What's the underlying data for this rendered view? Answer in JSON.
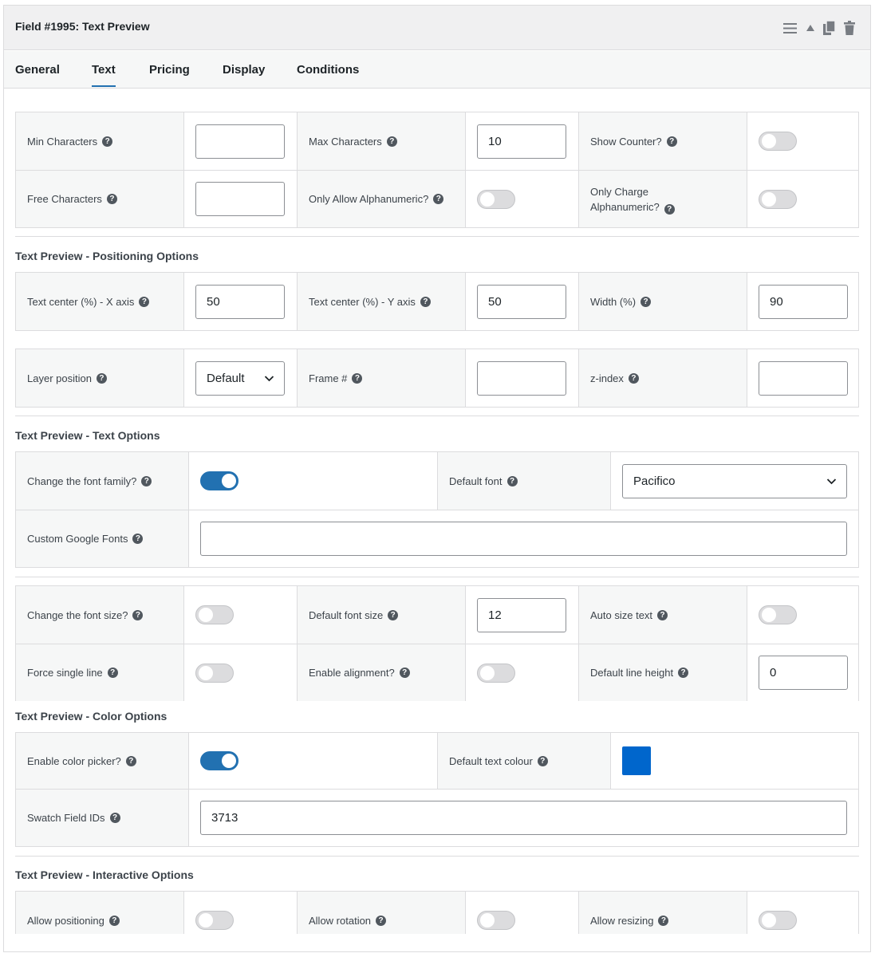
{
  "header": {
    "title": "Field #1995: Text Preview"
  },
  "tabs": [
    "General",
    "Text",
    "Pricing",
    "Display",
    "Conditions"
  ],
  "active_tab": "Text",
  "sections": {
    "positioning": "Text Preview - Positioning Options",
    "text": "Text Preview - Text Options",
    "color": "Text Preview - Color Options",
    "interactive": "Text Preview - Interactive Options"
  },
  "fields": {
    "min_chars": {
      "label": "Min Characters",
      "value": ""
    },
    "max_chars": {
      "label": "Max Characters",
      "value": "10"
    },
    "show_counter": {
      "label": "Show Counter?",
      "on": false
    },
    "free_chars": {
      "label": "Free Characters",
      "value": ""
    },
    "only_alnum": {
      "label": "Only Allow Alphanumeric?",
      "on": false
    },
    "charge_alnum": {
      "label_line1": "Only Charge",
      "label_line2": "Alphanumeric?",
      "on": false
    },
    "center_x": {
      "label": "Text center (%) - X axis",
      "value": "50"
    },
    "center_y": {
      "label": "Text center (%) - Y axis",
      "value": "50"
    },
    "width": {
      "label": "Width (%)",
      "value": "90"
    },
    "layer_position": {
      "label": "Layer position",
      "value": "Default"
    },
    "frame": {
      "label": "Frame #",
      "value": ""
    },
    "z_index": {
      "label": "z-index",
      "value": ""
    },
    "change_font_family": {
      "label": "Change the font family?",
      "on": true
    },
    "default_font": {
      "label": "Default font",
      "value": "Pacifico"
    },
    "custom_google_fonts": {
      "label": "Custom Google Fonts",
      "value": ""
    },
    "change_font_size": {
      "label": "Change the font size?",
      "on": false
    },
    "default_font_size": {
      "label": "Default font size",
      "value": "12"
    },
    "auto_size": {
      "label": "Auto size text",
      "on": false
    },
    "single_line": {
      "label": "Force single line",
      "on": false
    },
    "alignment": {
      "label": "Enable alignment?",
      "on": false
    },
    "line_height": {
      "label": "Default line height",
      "value": "0"
    },
    "color_picker": {
      "label": "Enable color picker?",
      "on": true
    },
    "default_colour": {
      "label": "Default text colour",
      "color": "#0066cc"
    },
    "swatch_ids": {
      "label": "Swatch Field IDs",
      "value": "3713"
    },
    "allow_positioning": {
      "label": "Allow positioning",
      "on": false
    },
    "allow_rotation": {
      "label": "Allow rotation",
      "on": false
    },
    "allow_resizing": {
      "label": "Allow resizing",
      "on": false
    }
  },
  "help_glyph": "?"
}
